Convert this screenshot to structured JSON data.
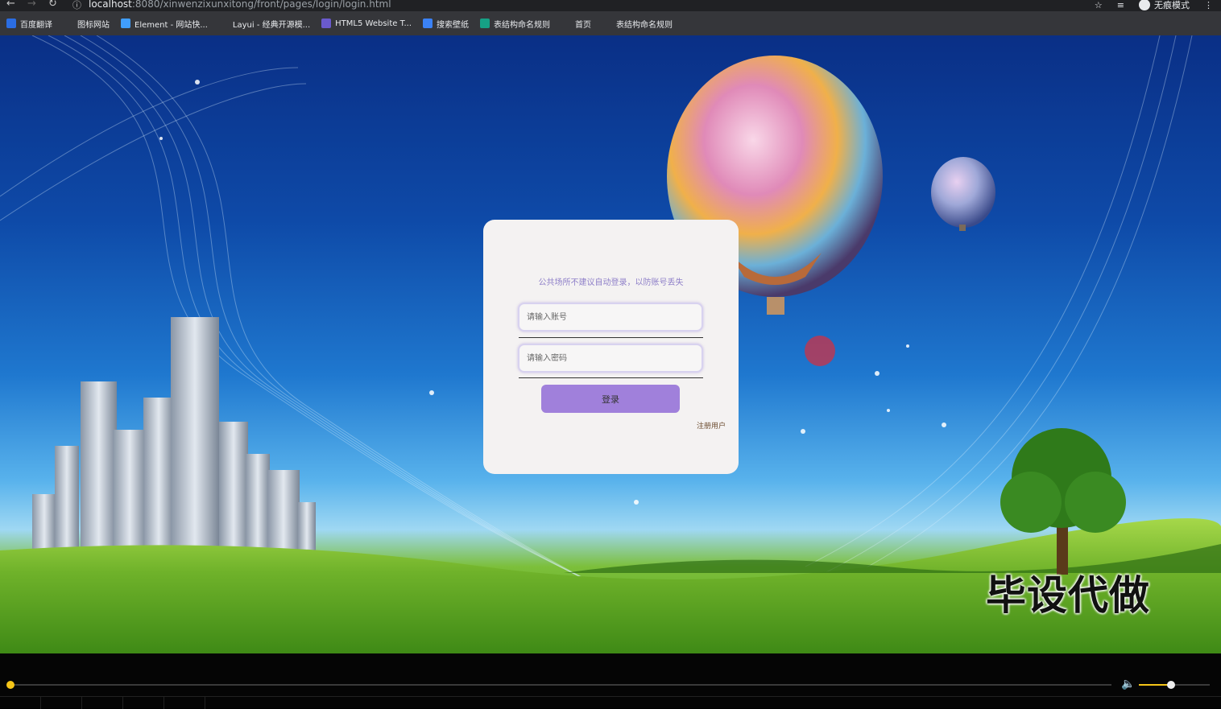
{
  "browser": {
    "url_host": "localhost",
    "url_rest": ":8080/xinwenzixunxitong/front/pages/login/login.html",
    "profile_label": "无痕模式",
    "bookmarks": [
      {
        "label": "百度翻译",
        "icon": "translate-icon",
        "color": "#2b6de2"
      },
      {
        "label": "图标网站",
        "icon": "flag-icon",
        "color": "#35363a"
      },
      {
        "label": "Element - 网站快...",
        "icon": "element-hex-icon",
        "color": "#409eff"
      },
      {
        "label": "Layui - 经典开源模...",
        "icon": "layui-icon",
        "color": "#35363a"
      },
      {
        "label": "HTML5 Website T...",
        "icon": "html5-template-icon",
        "color": "#6a5acd"
      },
      {
        "label": "搜索壁纸",
        "icon": "wallpaper-icon",
        "color": "#3b82f6"
      },
      {
        "label": "表结构命名规则",
        "icon": "table-icon",
        "color": "#16a085"
      },
      {
        "label": "首页",
        "icon": "globe-icon",
        "color": "#35363a"
      },
      {
        "label": "表结构命名规则",
        "icon": "globe-icon",
        "color": "#35363a"
      }
    ]
  },
  "login": {
    "hint": "公共场所不建议自动登录，以防账号丢失",
    "account_placeholder": "请输入账号",
    "password_placeholder": "请输入密码",
    "login_button": "登录",
    "register_link": "注册用户"
  },
  "overlay": {
    "watermark": "毕设代做"
  },
  "player": {
    "progress": 0.0,
    "volume": 0.45,
    "accent": "#f5c518"
  }
}
